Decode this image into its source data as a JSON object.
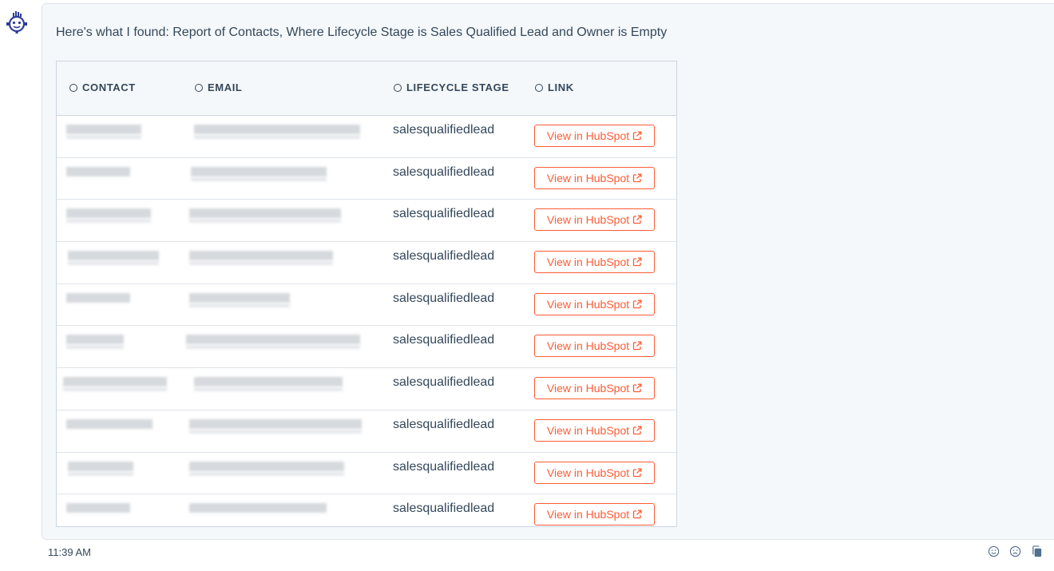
{
  "message": {
    "intro": "Here's what I found: Report of Contacts, Where Lifecycle Stage is Sales Qualified Lead and Owner is Empty",
    "timestamp": "11:39 AM"
  },
  "table": {
    "columns": [
      "CONTACT",
      "EMAIL",
      "LIFECYCLE STAGE",
      "LINK"
    ],
    "rows": [
      {
        "lifecycle_stage": "salesqualifiedlead",
        "link_label": "View in HubSpot"
      },
      {
        "lifecycle_stage": "salesqualifiedlead",
        "link_label": "View in HubSpot"
      },
      {
        "lifecycle_stage": "salesqualifiedlead",
        "link_label": "View in HubSpot"
      },
      {
        "lifecycle_stage": "salesqualifiedlead",
        "link_label": "View in HubSpot"
      },
      {
        "lifecycle_stage": "salesqualifiedlead",
        "link_label": "View in HubSpot"
      },
      {
        "lifecycle_stage": "salesqualifiedlead",
        "link_label": "View in HubSpot"
      },
      {
        "lifecycle_stage": "salesqualifiedlead",
        "link_label": "View in HubSpot"
      },
      {
        "lifecycle_stage": "salesqualifiedlead",
        "link_label": "View in HubSpot"
      },
      {
        "lifecycle_stage": "salesqualifiedlead",
        "link_label": "View in HubSpot"
      },
      {
        "lifecycle_stage": "salesqualifiedlead",
        "link_label": "View in HubSpot"
      }
    ]
  },
  "icons": {
    "avatar": "chatbot-avatar-icon",
    "sort": "sort-circle-icon",
    "external": "external-link-icon",
    "react_positive": "smiley-icon",
    "react_negative": "frown-icon",
    "copy": "copy-icon"
  },
  "colors": {
    "accent": "#ff5c35",
    "text": "#33475b",
    "avatar": "#2e3e9a",
    "bubble_bg": "#f5f8fa",
    "border": "#cbd6e2"
  }
}
